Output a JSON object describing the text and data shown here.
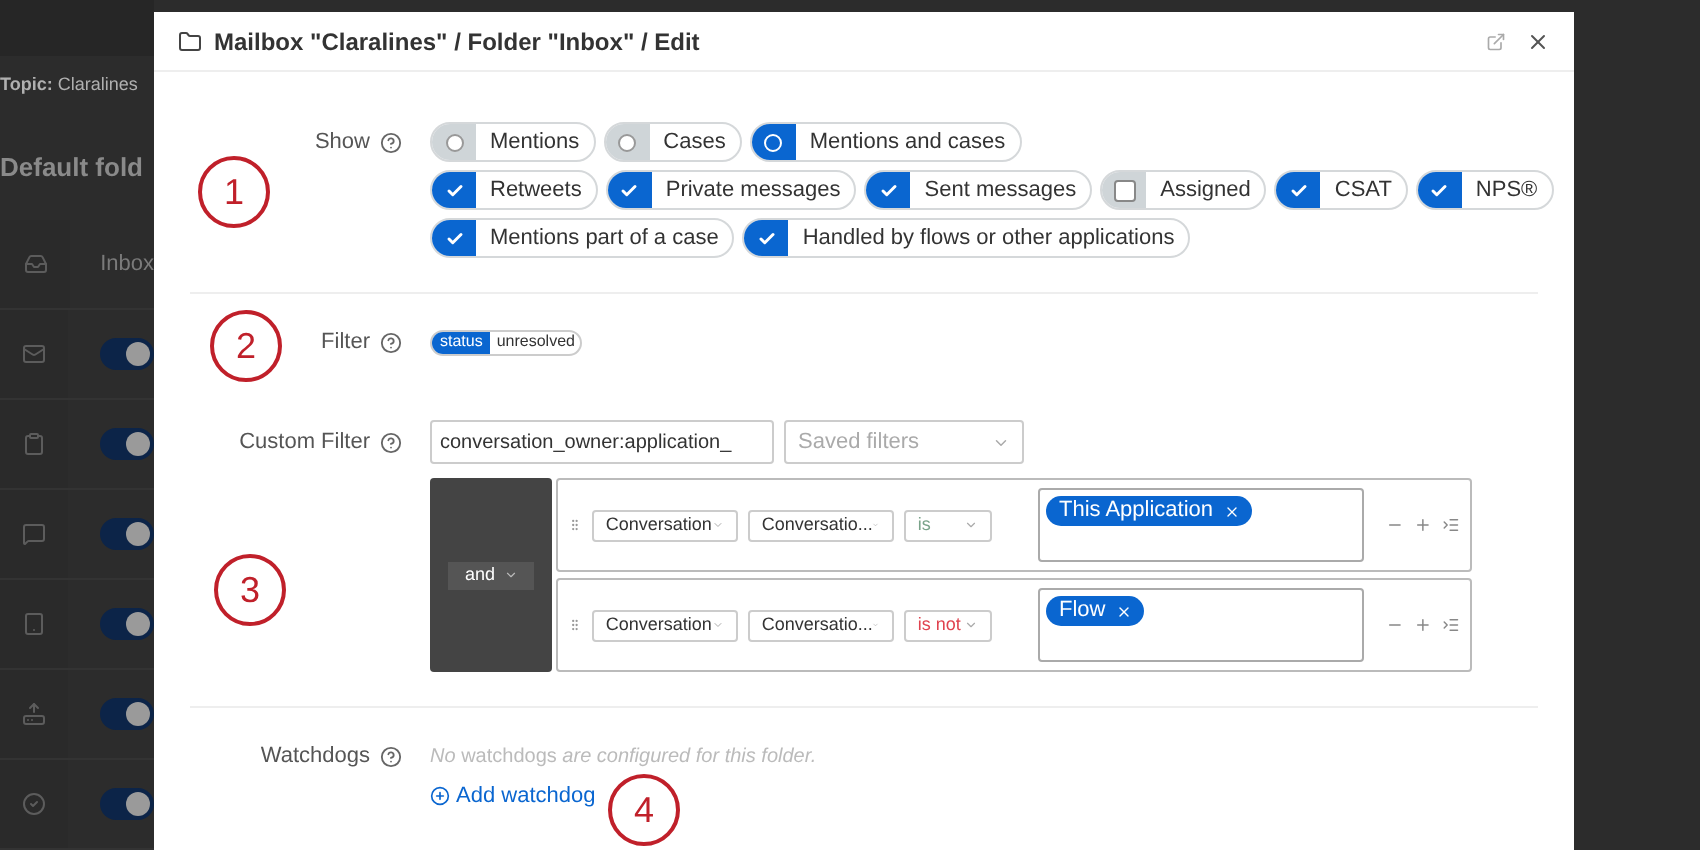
{
  "background": {
    "breadcrumb": "**Topic:** Claralines",
    "heading": "Default fold",
    "folders": [
      {
        "kind": "label",
        "label": "Inbox"
      },
      {
        "kind": "toggle",
        "on": true
      },
      {
        "kind": "toggle",
        "on": true
      },
      {
        "kind": "toggle",
        "on": true
      },
      {
        "kind": "toggle",
        "on": true
      },
      {
        "kind": "toggle",
        "on": true
      },
      {
        "kind": "toggle",
        "on": true
      }
    ]
  },
  "dialog": {
    "title": "Mailbox \"Claralines\" / Folder \"Inbox\" / Edit",
    "show": {
      "label": "Show",
      "modes": [
        {
          "label": "Mentions",
          "selected": false
        },
        {
          "label": "Cases",
          "selected": false
        },
        {
          "label": "Mentions and cases",
          "selected": true
        }
      ],
      "type_rows": [
        [
          {
            "label": "Retweets",
            "checked": true
          },
          {
            "label": "Private messages",
            "checked": true
          },
          {
            "label": "Sent messages",
            "checked": true
          },
          {
            "label": "Assigned",
            "checked": false
          },
          {
            "label": "CSAT",
            "checked": true
          },
          {
            "label": "NPS®",
            "checked": true
          }
        ],
        [
          {
            "label": "Mentions part of a case",
            "checked": true
          },
          {
            "label": "Handled by flows or other applications",
            "checked": true
          }
        ]
      ]
    },
    "filter": {
      "label": "Filter",
      "tag_key": "status",
      "tag_value": "unresolved"
    },
    "custom_filter": {
      "label": "Custom Filter",
      "value": "conversation_owner:application_",
      "saved_placeholder": "Saved filters",
      "operator": "and",
      "rules": [
        {
          "field": "Conversation",
          "subfield": "Conversatio...",
          "comparator": "is",
          "negated": false,
          "values": [
            "This Application"
          ]
        },
        {
          "field": "Conversation",
          "subfield": "Conversatio...",
          "comparator": "is not",
          "negated": true,
          "values": [
            "Flow"
          ]
        }
      ]
    },
    "watchdogs": {
      "label": "Watchdogs",
      "note": "*No* watchdogs *are configured for this folder.*",
      "add_link": "Add watchdog"
    }
  },
  "annotations": [
    "1",
    "2",
    "3",
    "4"
  ]
}
